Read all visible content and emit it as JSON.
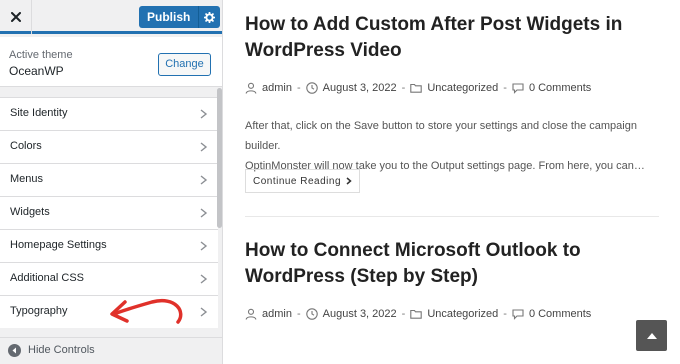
{
  "customizer": {
    "close_icon": "close-icon",
    "publish_label": "Publish",
    "publish_settings_icon": "gear-icon",
    "theme": {
      "label": "Active theme",
      "name": "OceanWP",
      "change_label": "Change"
    },
    "menu_items": [
      {
        "label": "Site Identity"
      },
      {
        "label": "Colors"
      },
      {
        "label": "Menus"
      },
      {
        "label": "Widgets"
      },
      {
        "label": "Homepage Settings"
      },
      {
        "label": "Additional CSS"
      },
      {
        "label": "Typography"
      }
    ],
    "hide_controls_label": "Hide Controls",
    "accent_color": "#2271b1",
    "annotation_arrow_color": "#e0312a"
  },
  "preview": {
    "posts": [
      {
        "title_line1": "How to Add Custom After Post Widgets in",
        "title_line2": "WordPress Video",
        "author": "admin",
        "date": "August 3, 2022",
        "category": "Uncategorized",
        "comments": "0 Comments",
        "excerpt_line1": "After that, click on the Save button to store your settings and close the campaign builder.",
        "excerpt_line2": "OptinMonster will now take you to the Output settings page. From here, you can…",
        "continue_label": "Continue Reading"
      },
      {
        "title_line1": "How to Connect Microsoft Outlook to",
        "title_line2": "WordPress (Step by Step)",
        "author": "admin",
        "date": "August 3, 2022",
        "category": "Uncategorized",
        "comments": "0 Comments"
      }
    ],
    "scroll_top_icon": "chevron-up-icon"
  }
}
